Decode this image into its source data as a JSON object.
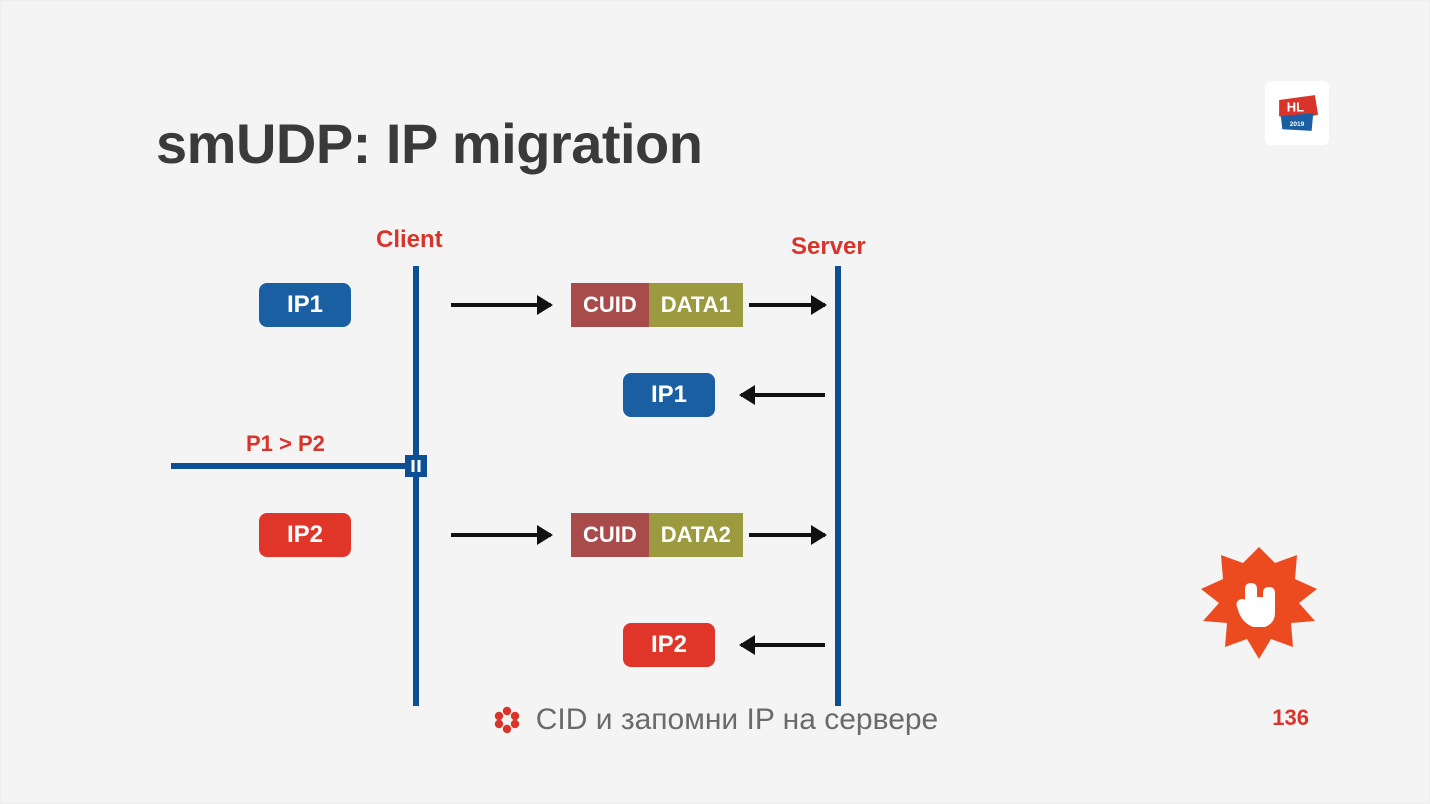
{
  "slide": {
    "title": "smUDP: IP migration",
    "page_number": "136",
    "footer_text": "CID и запомни IP на сервере",
    "logo_text": "HL",
    "logo_year": "2019"
  },
  "diagram": {
    "client_label": "Client",
    "server_label": "Server",
    "event_label": "P1 > P2",
    "rows": [
      {
        "src_ip": "IP1",
        "src_color": "blue",
        "cuid": "CUID",
        "data": "DATA1",
        "reply_ip": "IP1",
        "reply_color": "blue"
      },
      {
        "src_ip": "IP2",
        "src_color": "red",
        "cuid": "CUID",
        "data": "DATA2",
        "reply_ip": "IP2",
        "reply_color": "red"
      }
    ]
  }
}
